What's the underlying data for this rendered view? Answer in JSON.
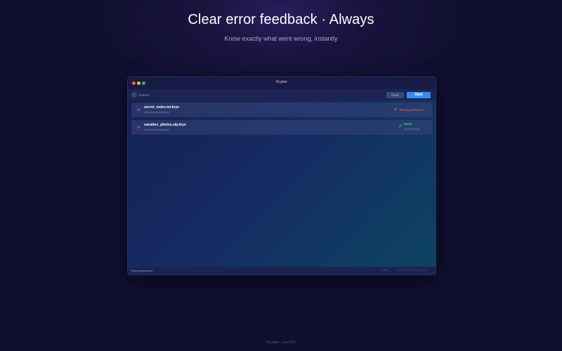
{
  "hero": {
    "title": "Clear error feedback · Always",
    "subtitle": "Know exactly what went wrong, instantly"
  },
  "window": {
    "title": "Krypter",
    "toolbar": {
      "options_label": "Options",
      "clear_label": "Clear",
      "start_label": "Start"
    },
    "files": [
      {
        "icon_letter": "P",
        "name": "secret_notes.txt.krye",
        "path": "/Users/sender/Desktop",
        "status": "error",
        "status_text": "Wrong password",
        "status_icon": "x-icon",
        "status_color": "#ff5c5c"
      },
      {
        "icon_letter": "P",
        "name": "vacation_photos.zip.krye",
        "path": "/Users/sender/Desktop",
        "status": "done",
        "status_text": "Done",
        "status_link": "Show in Finder",
        "status_icon": "check-icon",
        "status_color": "#3fd98a"
      }
    ],
    "statusbar": {
      "message": "Wrong password",
      "file_count": "2 files",
      "sys_text": "AES-256-GCM · Argon2id"
    }
  },
  "footer": {
    "text": "Krypter  ·  macOS"
  },
  "colors": {
    "accent": "#3b8bf2",
    "error": "#ff5c5c",
    "success": "#3fd98a",
    "background": "#100f30"
  }
}
